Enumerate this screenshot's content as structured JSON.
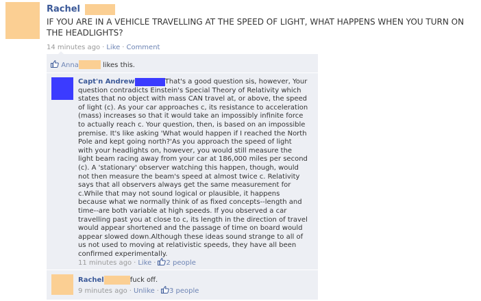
{
  "post": {
    "author": "Rachel",
    "text": "IF YOU ARE IN A VEHICLE TRAVELLING AT THE SPEED OF LIGHT, WHAT HAPPENS WHEN YOU TURN ON THE HEADLIGHTS?",
    "time": "14 minutes ago",
    "like_label": "Like",
    "comment_label": "Comment"
  },
  "likes": {
    "name": "Anna",
    "suffix": "likes this."
  },
  "comments": [
    {
      "author": "Capt'n Andrew",
      "text": "That's a good question sis, however, Your question contradicts Einstein's Special Theory of Relativity which states that no object with mass CAN travel at, or above, the speed of light (c). As your car approaches c, its resistance to acceleration (mass) increases so that it would take an impossibly infinite force to actually reach c. Your question, then, is based on an impossible premise. It's like asking 'What would happen if I reached the North Pole and kept going north?'As you approach the speed of light with your headlights on, however, you would still measure the light beam racing away from your car at 186,000 miles per second (c). A 'stationary' observer watching this happen, though, would not then measure the beam's speed at almost twice c. Relativity says that all observers always get the same measurement for c.While that may not sound logical or plausible, it happens because what we normally think of as fixed concepts--length and time--are both variable at high speeds. If you observed a car travelling past you at close to c, its length in the direction of travel would appear shortened and the passage of time on board would appear slowed down.Although these ideas sound strange to all of us not used to moving at relativistic speeds, they have all been confirmed experimentally.",
      "time": "11 minutes ago",
      "action": "Like",
      "likes": "2 people"
    },
    {
      "author": "Rachel",
      "text": "fuck off.",
      "time": "9 minutes ago",
      "action": "Unlike",
      "likes": "3 people"
    }
  ],
  "colors": {
    "link": "#3b5998",
    "link_light": "#6d84b4",
    "comment_bg": "#edeff4",
    "redact_peach": "#fbcf93",
    "redact_blue": "#3b3bff"
  }
}
